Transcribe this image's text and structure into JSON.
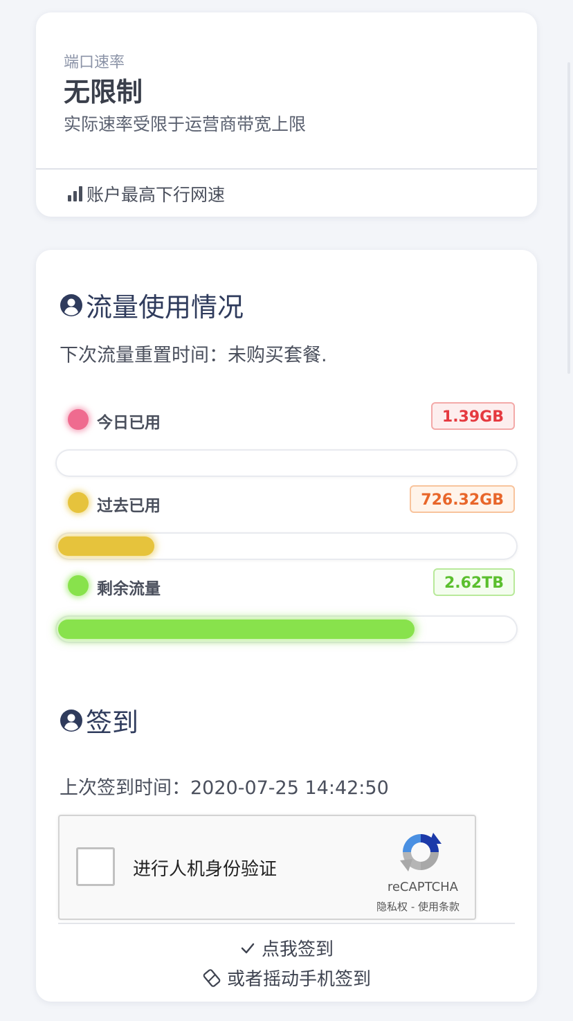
{
  "speed_card": {
    "label": "端口速率",
    "value": "无限制",
    "description": "实际速率受限于运营商带宽上限",
    "footer": "账户最高下行网速"
  },
  "traffic_card": {
    "title": "流量使用情况",
    "reset_text": "下次流量重置时间：未购买套餐.",
    "items": [
      {
        "label": "今日已用",
        "value": "1.39GB",
        "fill_fraction": 0.0,
        "color": "#ef6b8f",
        "badge_color": "#e5393f",
        "badge_bg": "#fdeeee",
        "badge_border": "#f3a9a8"
      },
      {
        "label": "过去已用",
        "value": "726.32GB",
        "fill_fraction": 0.21,
        "color": "#e6c33c",
        "badge_color": "#e8662a",
        "badge_bg": "#fff4ea",
        "badge_border": "#f8c39c"
      },
      {
        "label": "剩余流量",
        "value": "2.62TB",
        "fill_fraction": 0.78,
        "color": "#88e24c",
        "badge_color": "#5bbf2e",
        "badge_bg": "#f4fdef",
        "badge_border": "#b8e99a"
      }
    ]
  },
  "checkin": {
    "title": "签到",
    "last_checkin": "上次签到时间：2020-07-25 14:42:50",
    "recaptcha_label": "进行人机身份验证",
    "recaptcha_brand": "reCAPTCHA",
    "recaptcha_terms": "隐私权 - 使用条款",
    "button_label": "点我签到",
    "shake_label": "或者摇动手机签到"
  },
  "colors": {
    "title": "#2f3b5c",
    "accent_blue": "#4a90e2"
  }
}
